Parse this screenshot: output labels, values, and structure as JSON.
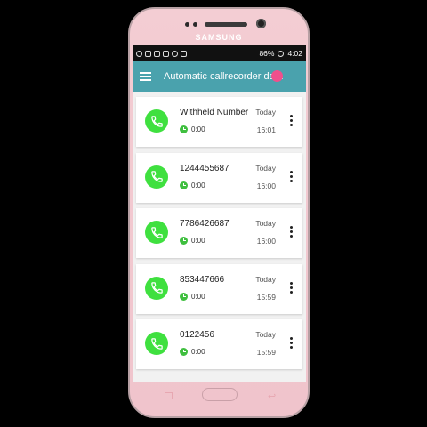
{
  "device": {
    "brand": "SAMSUNG"
  },
  "status": {
    "battery": "86%",
    "time": "4:02"
  },
  "appbar": {
    "title": "Automatic callrecorder data"
  },
  "calls": [
    {
      "name": "Withheld Number",
      "duration": "0:00",
      "day": "Today",
      "time": "16:01"
    },
    {
      "name": "1244455687",
      "duration": "0:00",
      "day": "Today",
      "time": "16:00"
    },
    {
      "name": "7786426687",
      "duration": "0:00",
      "day": "Today",
      "time": "16:00"
    },
    {
      "name": "853447666",
      "duration": "0:00",
      "day": "Today",
      "time": "15:59"
    },
    {
      "name": "0122456",
      "duration": "0:00",
      "day": "Today",
      "time": "15:59"
    }
  ],
  "colors": {
    "appbar": "#4aa2ad",
    "avatar": "#3fe03f",
    "touch_indicator": "#f0508c"
  }
}
